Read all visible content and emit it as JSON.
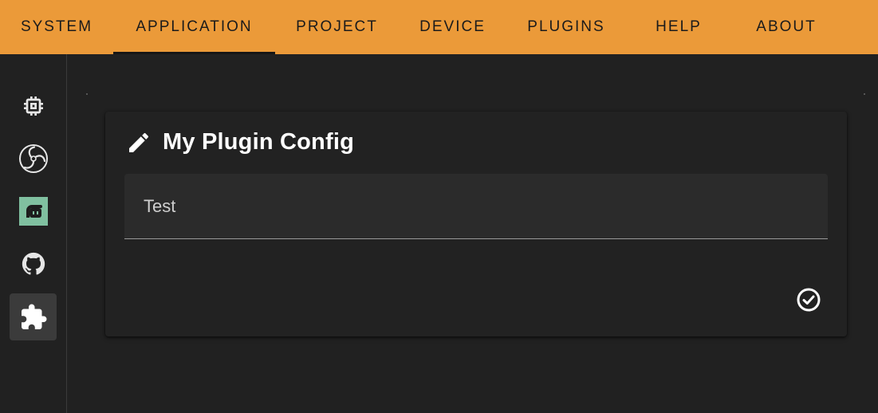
{
  "menu": {
    "tabs": [
      {
        "label": "SYSTEM"
      },
      {
        "label": "APPLICATION",
        "active": true
      },
      {
        "label": "PROJECT"
      },
      {
        "label": "DEVICE"
      },
      {
        "label": "PLUGINS"
      },
      {
        "label": "HELP"
      },
      {
        "label": "ABOUT"
      }
    ]
  },
  "sidebar": {
    "items": [
      {
        "icon": "chip-icon"
      },
      {
        "icon": "obs-icon"
      },
      {
        "icon": "streamlabs-icon"
      },
      {
        "icon": "github-icon"
      },
      {
        "icon": "puzzle-icon",
        "active": true
      }
    ]
  },
  "card": {
    "title": "My Plugin Config",
    "field_value": "Test"
  },
  "colors": {
    "accent": "#eb9a39",
    "background": "#212121",
    "card": "#222222",
    "field": "#2b2b2b",
    "streamlabs": "#80c0a0"
  }
}
